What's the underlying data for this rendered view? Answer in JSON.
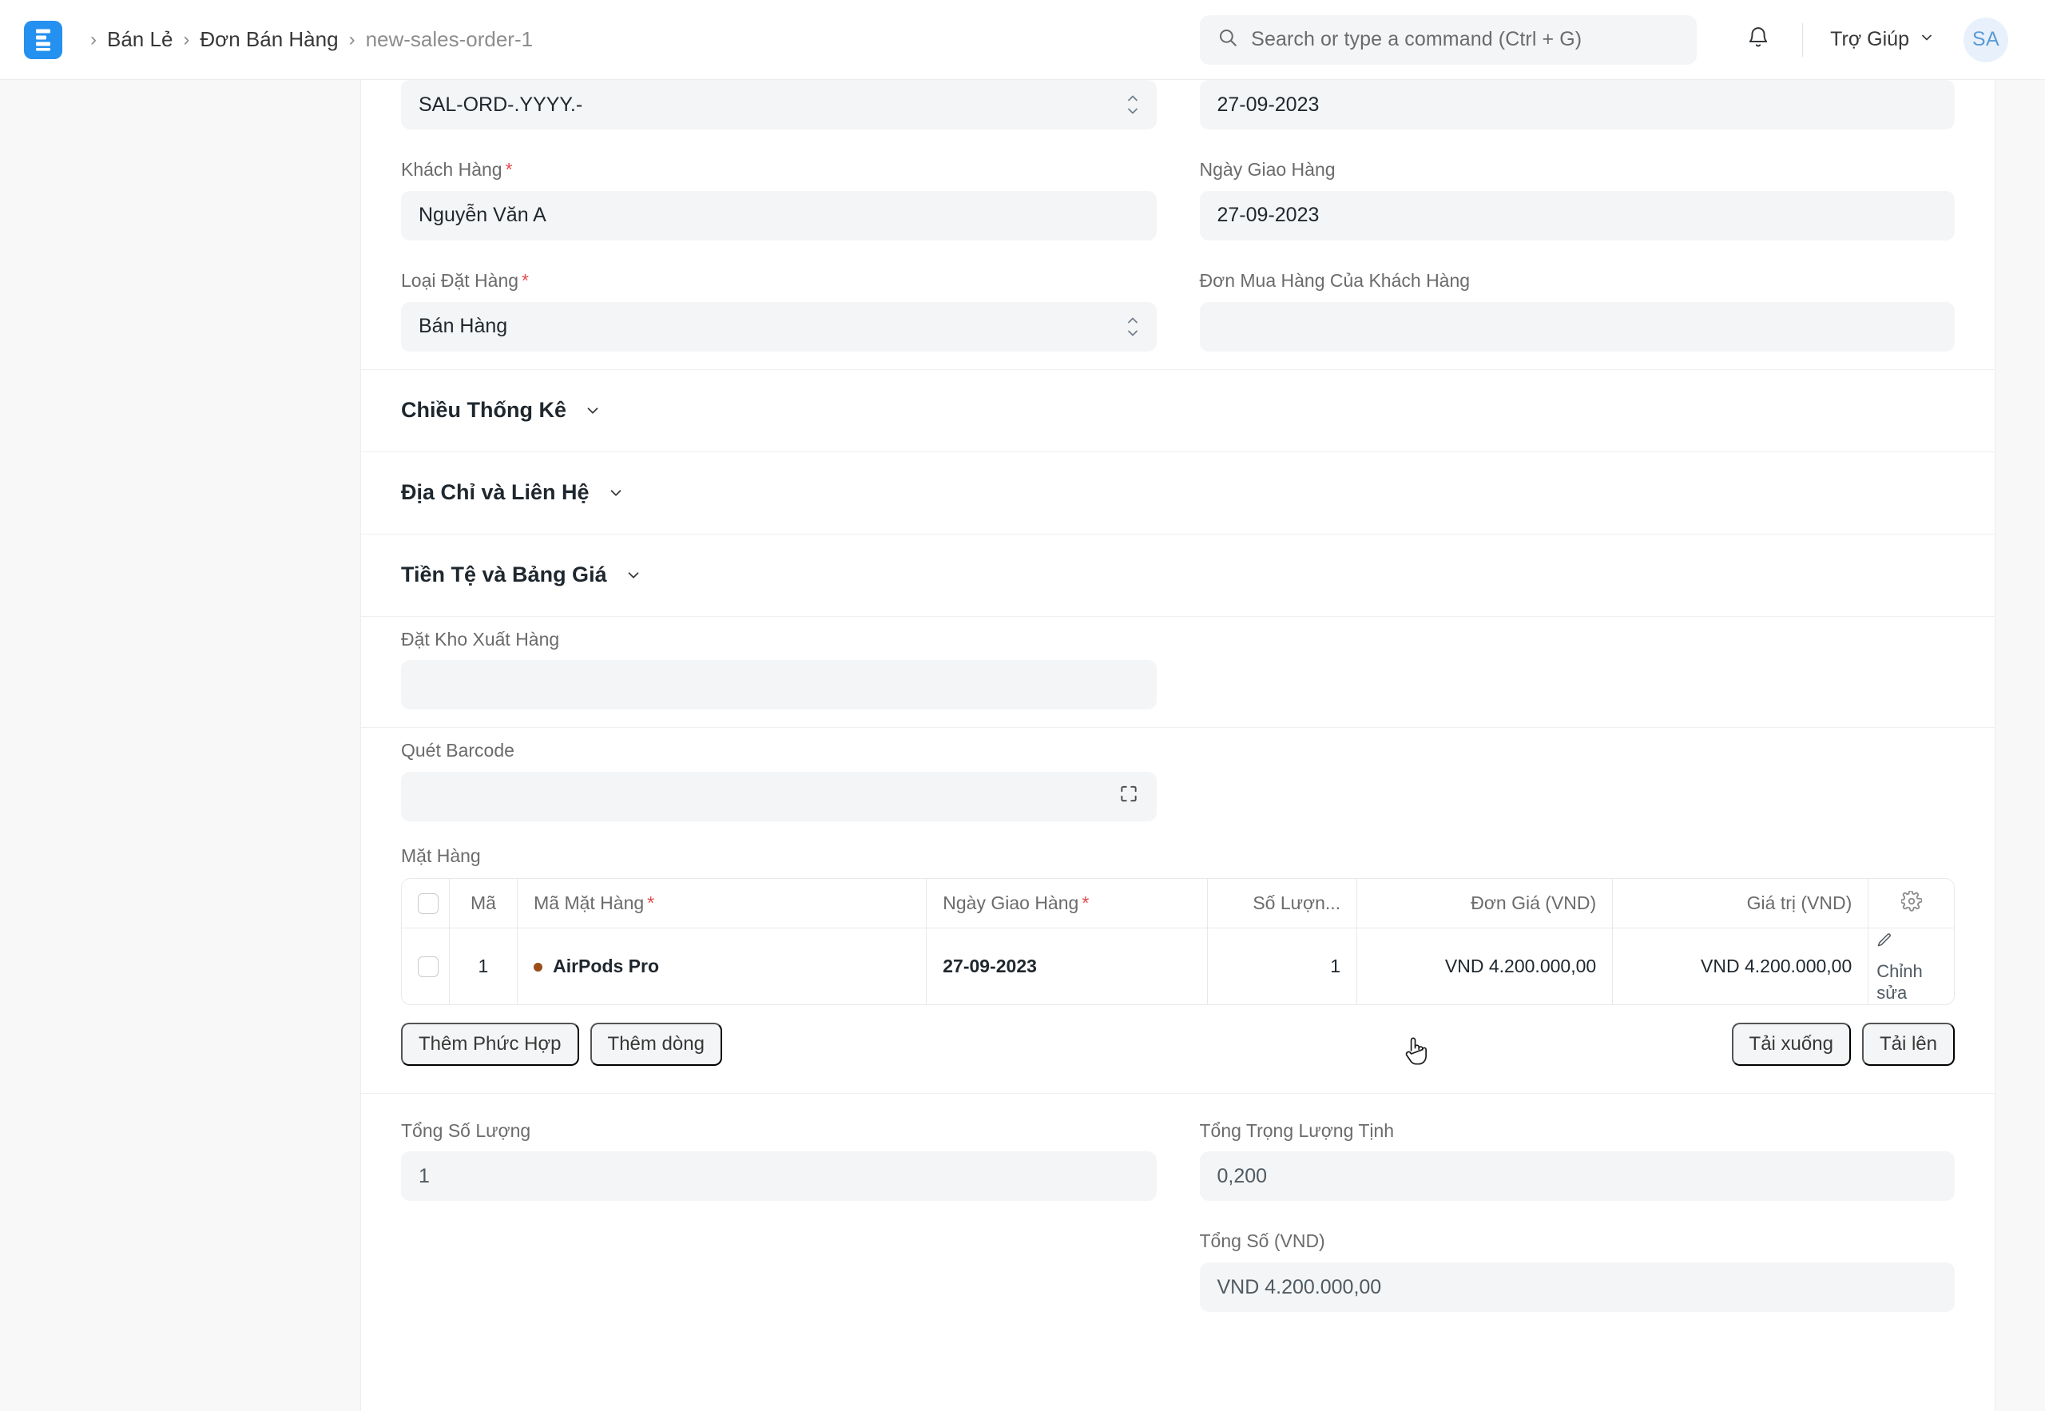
{
  "navbar": {
    "logo_icon": "erpnext-logo-icon",
    "breadcrumb": {
      "separator": "›",
      "items": [
        {
          "label": "Bán Lẻ",
          "current": false
        },
        {
          "label": "Đơn Bán Hàng",
          "current": false
        },
        {
          "label": "new-sales-order-1",
          "current": true
        }
      ]
    },
    "search": {
      "icon": "search-icon",
      "placeholder": "Search or type a command (Ctrl + G)",
      "value": ""
    },
    "notifications_icon": "bell-icon",
    "help": {
      "label": "Trợ Giúp",
      "caret_icon": "chevron-down-icon"
    },
    "avatar": {
      "initials": "SA",
      "bg": "#e8f1fb",
      "fg": "#5b9bd5"
    }
  },
  "form": {
    "naming_series": {
      "value": "SAL-ORD-.YYYY.-",
      "caret_icon": "select-stepper-icon"
    },
    "date": {
      "label": "",
      "value": "27-09-2023"
    },
    "customer": {
      "label": "Khách Hàng",
      "required": true,
      "value": "Nguyễn Văn A"
    },
    "delivery_date": {
      "label": "Ngày Giao Hàng",
      "required": false,
      "value": "27-09-2023"
    },
    "order_type": {
      "label": "Loại Đặt Hàng",
      "required": true,
      "value": "Bán Hàng",
      "caret_icon": "select-stepper-icon"
    },
    "customer_po": {
      "label": "Đơn Mua Hàng Của Khách Hàng",
      "required": false,
      "value": ""
    },
    "sections": [
      {
        "title": "Chiều Thống Kê",
        "chevron_icon": "chevron-down-icon",
        "collapsed": true
      },
      {
        "title": "Địa Chỉ và Liên Hệ",
        "chevron_icon": "chevron-down-icon",
        "collapsed": true
      },
      {
        "title": "Tiền Tệ và Bảng Giá",
        "chevron_icon": "chevron-down-icon",
        "collapsed": true
      }
    ],
    "set_warehouse": {
      "label": "Đặt Kho Xuất Hàng",
      "value": ""
    },
    "scan_barcode": {
      "label": "Quét Barcode",
      "value": "",
      "icon": "barcode-scan-icon"
    }
  },
  "items_grid": {
    "label": "Mặt Hàng",
    "columns": [
      {
        "key": "check",
        "label": "",
        "icon": "checkbox-icon",
        "align": "center"
      },
      {
        "key": "idx",
        "label": "Mã",
        "align": "center"
      },
      {
        "key": "item_code",
        "label": "Mã Mặt Hàng",
        "required": true,
        "align": "left"
      },
      {
        "key": "delivery_date",
        "label": "Ngày Giao Hàng",
        "required": true,
        "align": "left"
      },
      {
        "key": "qty",
        "label": "Số Lượn...",
        "align": "right"
      },
      {
        "key": "rate",
        "label": "Đơn Giá (VND)",
        "align": "right"
      },
      {
        "key": "amount",
        "label": "Giá trị (VND)",
        "align": "right"
      },
      {
        "key": "settings",
        "label": "",
        "icon": "gear-icon",
        "align": "center"
      }
    ],
    "rows": [
      {
        "checked": false,
        "idx": "1",
        "item_code": "AirPods Pro",
        "status_dot_color": "#9b4d18",
        "delivery_date": "27-09-2023",
        "qty": "1",
        "rate": "VND 4.200.000,00",
        "amount": "VND 4.200.000,00",
        "edit_label": "Chỉnh sửa",
        "edit_icon": "pencil-icon"
      }
    ],
    "buttons_left": [
      {
        "label": "Thêm Phức Hợp",
        "name": "add-multiple-button"
      },
      {
        "label": "Thêm dòng",
        "name": "add-row-button"
      }
    ],
    "buttons_right": [
      {
        "label": "Tải xuống",
        "name": "download-button"
      },
      {
        "label": "Tải lên",
        "name": "upload-button"
      }
    ]
  },
  "totals": {
    "total_qty": {
      "label": "Tổng Số Lượng",
      "value": "1"
    },
    "total_net_weight": {
      "label": "Tổng Trọng Lượng Tịnh",
      "value": "0,200"
    },
    "total_amount": {
      "label": "Tổng Số (VND)",
      "value": "VND 4.200.000,00"
    }
  },
  "colors": {
    "accent": "#2490ef",
    "required_star": "#e24c4c",
    "control_bg": "#f4f5f6",
    "page_bg": "#f8f8f8",
    "item_dot": "#9b4d18"
  }
}
